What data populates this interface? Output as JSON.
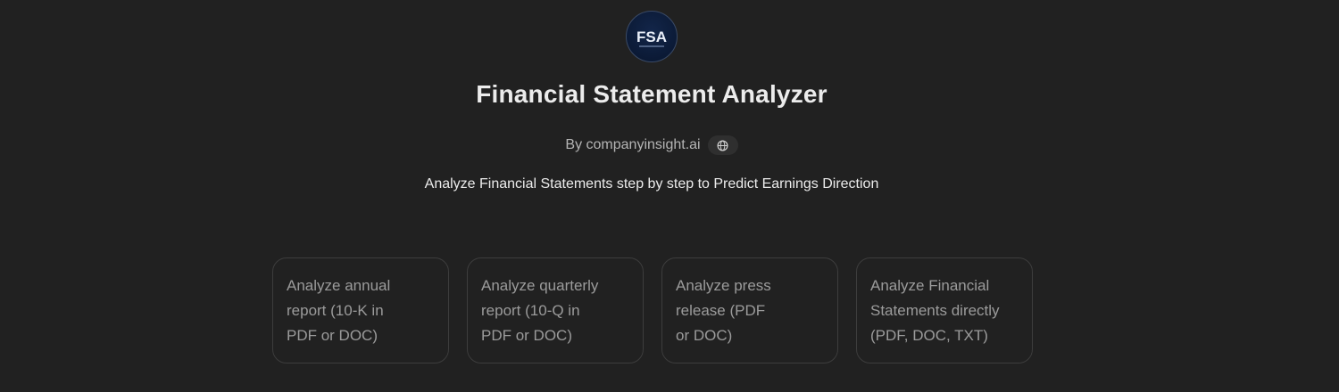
{
  "logo": {
    "text": "FSA",
    "bg": "#0b1a36"
  },
  "title": "Financial Statement Analyzer",
  "byline": {
    "author": "By companyinsight.ai",
    "icon": "globe-icon"
  },
  "tagline": "Analyze Financial Statements step by step to Predict Earnings Direction",
  "starters": [
    {
      "lines": [
        "Analyze annual",
        "report (10-K in",
        "PDF or DOC)"
      ]
    },
    {
      "lines": [
        "Analyze quarterly",
        "report (10-Q in",
        "PDF or DOC)"
      ]
    },
    {
      "lines": [
        "Analyze press",
        "release (PDF",
        "or DOC)"
      ]
    },
    {
      "lines": [
        "Analyze Financial",
        "Statements directly",
        "(PDF, DOC, TXT)"
      ]
    }
  ],
  "colors": {
    "background": "#212121",
    "card_border": "#3d3d3d",
    "muted_text": "#9b9b9b"
  }
}
